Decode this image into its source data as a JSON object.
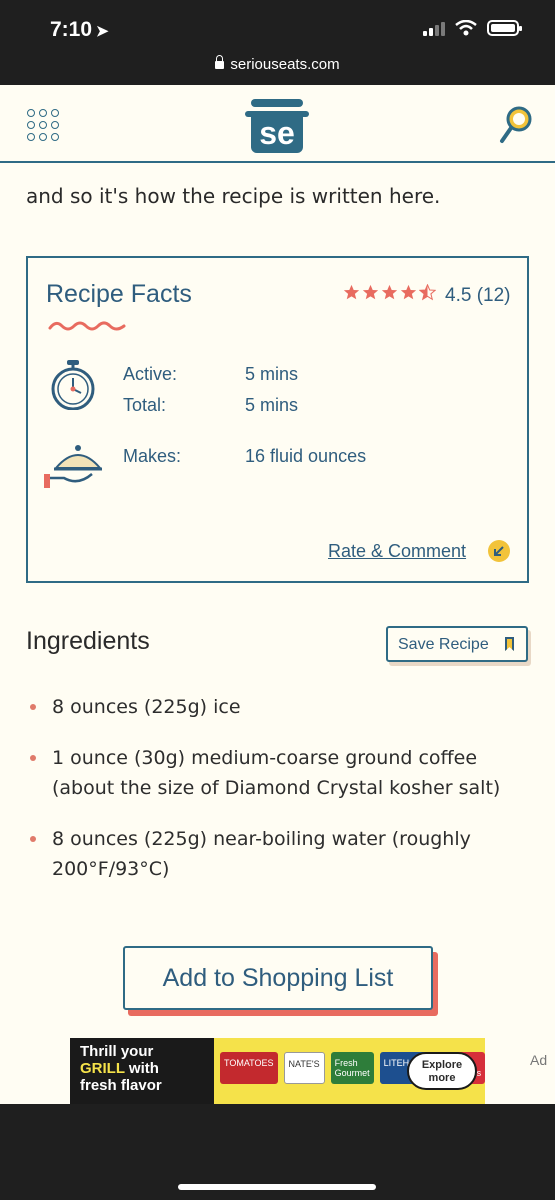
{
  "status_bar": {
    "time": "7:10"
  },
  "browser": {
    "url": "seriouseats.com"
  },
  "header": {
    "logo_text": "se"
  },
  "intro": {
    "text": "and so it's how the recipe is written here."
  },
  "recipe_facts": {
    "title": "Recipe Facts",
    "rating": {
      "stars": 4.5,
      "text": "4.5 (12)"
    },
    "active_label": "Active:",
    "active_value": "5 mins",
    "total_label": "Total:",
    "total_value": "5 mins",
    "makes_label": "Makes:",
    "makes_value": "16 fluid ounces",
    "rate_link": "Rate & Comment"
  },
  "ingredients": {
    "title": "Ingredients",
    "save_label": "Save Recipe",
    "items": [
      "8 ounces (225g) ice",
      "1 ounce (30g) medium-coarse ground coffee (about the size of Diamond Crystal kosher salt)",
      "8 ounces (225g) near-boiling water (roughly 200°F/93°C)"
    ]
  },
  "shopping_button": {
    "label": "Add to Shopping List"
  },
  "ad": {
    "line1": "Thrill your",
    "line2_a": "GRILL",
    "line2_b": "with",
    "line3": "fresh flavor",
    "brands": [
      "TOMATOES",
      "NATE'S",
      "Fresh Gourmet",
      "LITEHOUSE",
      "Fresh Express"
    ],
    "cta": "Explore more",
    "label": "Ad"
  },
  "colors": {
    "brand_blue": "#2f6b85",
    "accent_red": "#e86b5f",
    "accent_yellow": "#f2c33a",
    "background": "#fffdf3"
  }
}
